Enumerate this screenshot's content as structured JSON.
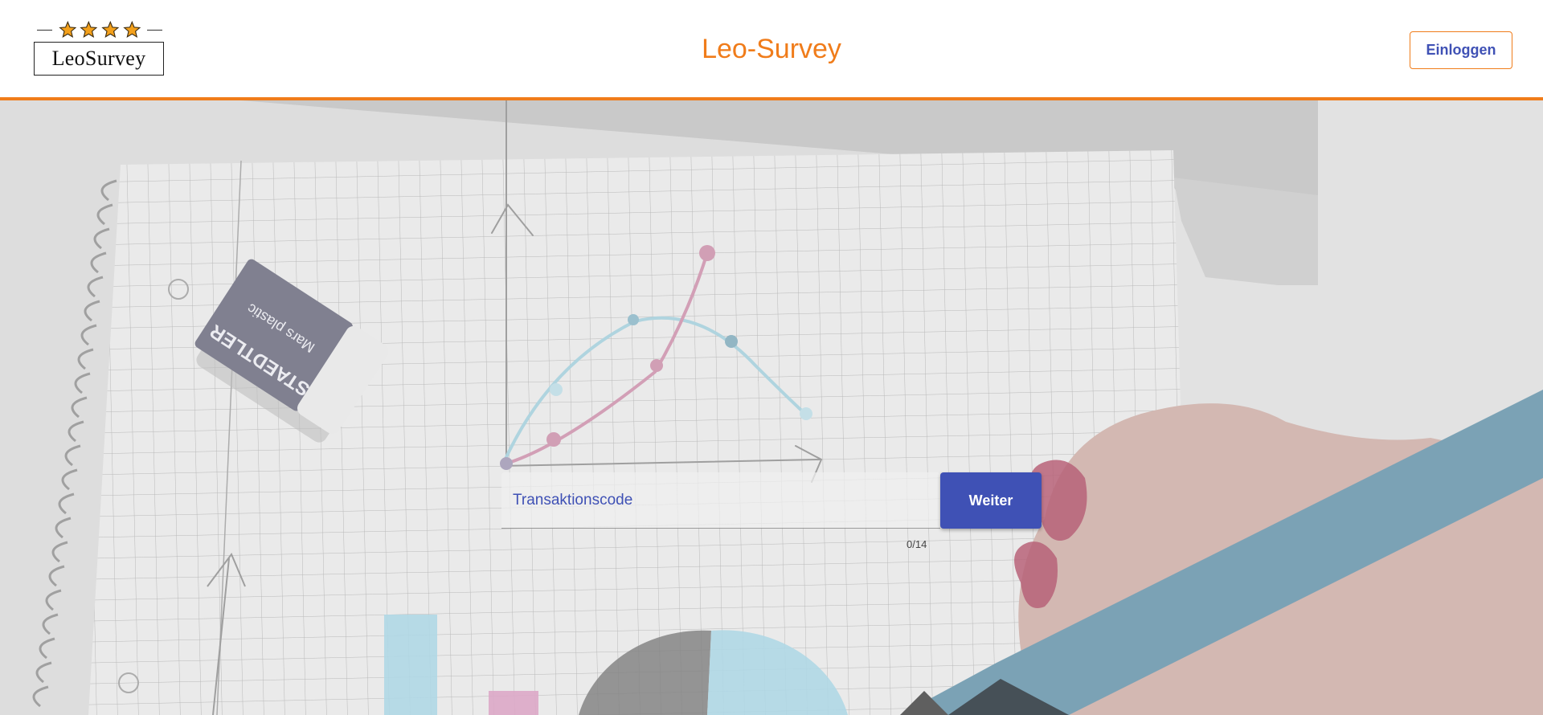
{
  "header": {
    "logo_text": "LeoSurvey",
    "logo_stars": 4,
    "title": "Leo-Survey",
    "login_label": "Einloggen"
  },
  "hero": {
    "eraser_brand": "STAEDTLER",
    "eraser_model": "Mars plastic"
  },
  "form": {
    "input_placeholder": "Transaktionscode",
    "input_value": "",
    "counter": "0/14",
    "continue_label": "Weiter"
  },
  "colors": {
    "accent": "#f07c1a",
    "primary": "#3f51b5",
    "star": "#f3a01b"
  },
  "icons": {
    "logo_star": "star-icon"
  }
}
